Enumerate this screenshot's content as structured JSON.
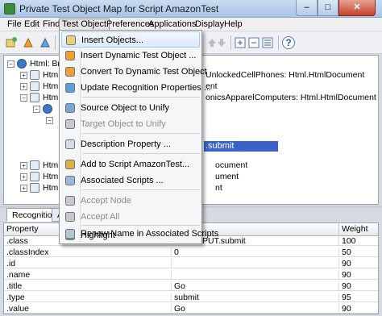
{
  "window": {
    "title": "Private Test Object Map for Script AmazonTest",
    "minimize_glyph": "–",
    "maximize_glyph": "□",
    "close_glyph": "✕"
  },
  "menubar": {
    "items": [
      "File",
      "Edit",
      "Find",
      "Test Object",
      "Preferences",
      "Applications",
      "Display",
      "Help"
    ],
    "active": "Test Object"
  },
  "toolbar": {
    "icons": [
      "insert-object-icon",
      "insert-dynamic-icon",
      "convert-dynamic-icon",
      "update-recognition-icon",
      "source-unify-icon",
      "target-unify-icon",
      "description-icon",
      "move-up-icon",
      "move-down-icon",
      "expand-icon",
      "collapse-icon",
      "filter-icon",
      "help-icon"
    ],
    "help_glyph": "?"
  },
  "tree": {
    "rows": [
      {
        "text": "Html: Brov",
        "suffix": ""
      },
      {
        "text": "Html: I",
        "suffix": "UnlockedCellPhones: Html.HtmlDocument"
      },
      {
        "text": "Html: I",
        "suffix": "ent"
      },
      {
        "text": "Html: I",
        "suffix": "onicsApparelComputers: Html.HtmlDocument"
      },
      {
        "text": "",
        "suffix": ""
      },
      {
        "text": "",
        "suffix": ""
      },
      {
        "text": "",
        "suffix": ".submit"
      },
      {
        "text": "Html: I",
        "suffix": "ocument"
      },
      {
        "text": "Html: I",
        "suffix": "ument"
      },
      {
        "text": "Html: I",
        "suffix": "nt"
      }
    ]
  },
  "tabs": [
    "Recognition",
    "Ad"
  ],
  "properties": {
    "headers": [
      "Property",
      "Value",
      "Weight"
    ],
    "rows": [
      {
        "property": ".class",
        "value": "Html.INPUT.submit",
        "weight": "100"
      },
      {
        "property": ".classIndex",
        "value": "0",
        "weight": "50"
      },
      {
        "property": ".id",
        "value": "",
        "weight": "90"
      },
      {
        "property": ".name",
        "value": "",
        "weight": "90"
      },
      {
        "property": ".title",
        "value": "Go",
        "weight": "90"
      },
      {
        "property": ".type",
        "value": "submit",
        "weight": "95"
      },
      {
        "property": ".value",
        "value": "Go",
        "weight": "90"
      }
    ]
  },
  "dropdown": {
    "items": [
      {
        "label": "Insert Objects...",
        "icon": "insert-objects-icon",
        "state": "hover"
      },
      {
        "label": "Insert Dynamic Test Object ...",
        "icon": "insert-dynamic-icon",
        "state": "normal"
      },
      {
        "label": "Convert To Dynamic Test Object",
        "icon": "convert-dynamic-icon",
        "state": "normal"
      },
      {
        "label": "Update Recognition Properties ...",
        "icon": "update-recognition-icon",
        "state": "normal"
      },
      {
        "label": "Source Object to Unify",
        "icon": "source-unify-icon",
        "state": "normal"
      },
      {
        "label": "Target Object to Unify",
        "icon": "target-unify-icon",
        "state": "disabled"
      },
      {
        "label": "Description Property ...",
        "icon": "description-property-icon",
        "state": "normal"
      },
      {
        "label": "Add to Script AmazonTest...",
        "icon": "add-to-script-icon",
        "state": "normal"
      },
      {
        "label": "Associated Scripts ...",
        "icon": "associated-scripts-icon",
        "state": "normal"
      },
      {
        "label": "Accept Node",
        "icon": "accept-node-icon",
        "state": "disabled"
      },
      {
        "label": "Accept All",
        "icon": "accept-all-icon",
        "state": "disabled"
      },
      {
        "label": "Highlight",
        "icon": "highlight-icon",
        "state": "normal"
      },
      {
        "label": "Renew Name in Associated Scripts",
        "icon": "renew-name-icon",
        "state": "normal"
      }
    ]
  }
}
